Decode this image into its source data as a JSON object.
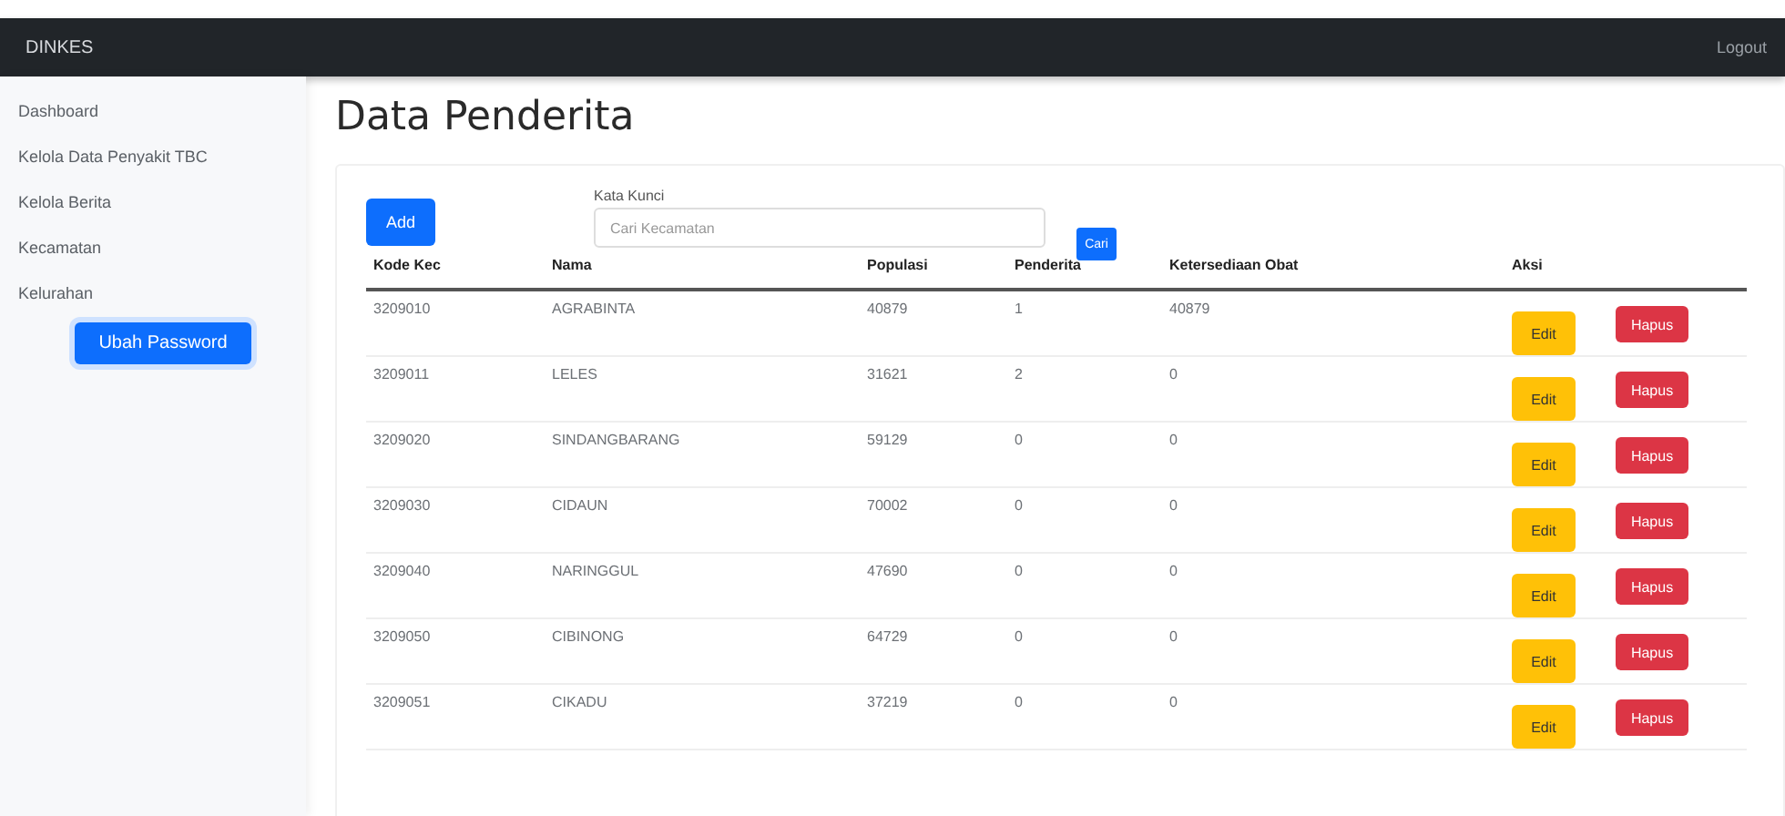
{
  "navbar": {
    "brand": "DINKES",
    "logout": "Logout"
  },
  "sidebar": {
    "items": [
      {
        "label": "Dashboard"
      },
      {
        "label": "Kelola Data Penyakit TBC"
      },
      {
        "label": "Kelola Berita"
      },
      {
        "label": "Kecamatan"
      },
      {
        "label": "Kelurahan"
      }
    ],
    "button": "Ubah Password"
  },
  "page_title": "Data Penderita",
  "toolbar": {
    "add_button": "Add",
    "search_label": "Kata Kunci",
    "search_placeholder": "Cari Kecamatan",
    "search_button": "Cari"
  },
  "table": {
    "columns": [
      "Kode Kec",
      "Nama",
      "Populasi",
      "Penderita",
      "Ketersediaan Obat",
      "Aksi"
    ],
    "rows": [
      {
        "cells": [
          "3209010",
          "AGRABINTA",
          "40879",
          "1",
          "40879"
        ],
        "edit": "Edit",
        "delete": "Hapus"
      },
      {
        "cells": [
          "3209011",
          "LELES",
          "31621",
          "2",
          "0"
        ],
        "edit": "Edit",
        "delete": "Hapus"
      },
      {
        "cells": [
          "3209020",
          "SINDANGBARANG",
          "59129",
          "0",
          "0"
        ],
        "edit": "Edit",
        "delete": "Hapus"
      },
      {
        "cells": [
          "3209030",
          "CIDAUN",
          "70002",
          "0",
          "0"
        ],
        "edit": "Edit",
        "delete": "Hapus"
      },
      {
        "cells": [
          "3209040",
          "NARINGGUL",
          "47690",
          "0",
          "0"
        ],
        "edit": "Edit",
        "delete": "Hapus"
      },
      {
        "cells": [
          "3209050",
          "CIBINONG",
          "64729",
          "0",
          "0"
        ],
        "edit": "Edit",
        "delete": "Hapus"
      },
      {
        "cells": [
          "3209051",
          "CIKADU",
          "37219",
          "0",
          "0"
        ],
        "edit": "Edit",
        "delete": "Hapus"
      }
    ]
  }
}
